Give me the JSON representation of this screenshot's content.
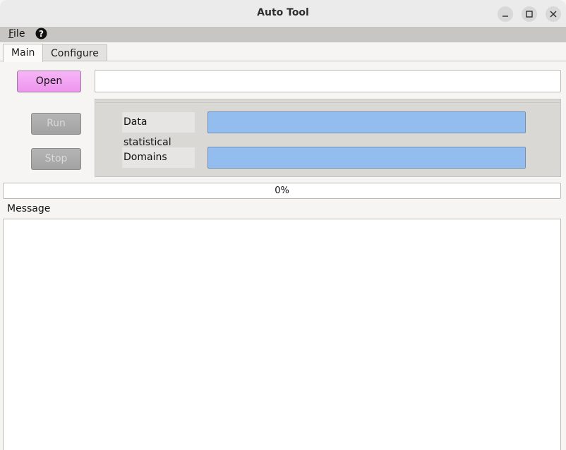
{
  "window": {
    "title": "Auto Tool",
    "controls": [
      "minimize-icon",
      "maximize-icon",
      "close-icon"
    ]
  },
  "menu": {
    "file_first": "F",
    "file_rest": "ile",
    "help_icon": "help-icon"
  },
  "tabs": [
    {
      "label": "Main",
      "active": true
    },
    {
      "label": "Configure",
      "active": false
    }
  ],
  "main": {
    "open_label": "Open",
    "path_value": "",
    "run_label": "Run",
    "stop_label": "Stop",
    "data_statistical_label": "Data statistical",
    "data_statistical_value": "",
    "domains_label": "Domains",
    "domains_value": "",
    "progress_text": "0%",
    "progress_value": 0,
    "message_label": "Message",
    "message_text": ""
  },
  "colors": {
    "open_button": "#ee95ee",
    "field_fill": "#94bdef",
    "disabled_button": "#a9a9a9"
  }
}
